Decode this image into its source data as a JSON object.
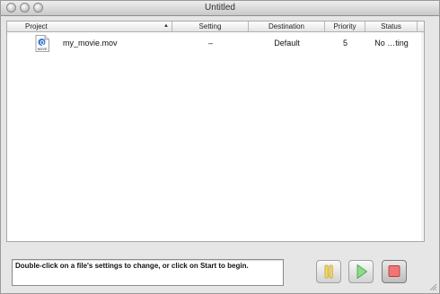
{
  "window": {
    "title": "Untitled"
  },
  "table": {
    "columns": [
      {
        "key": "project",
        "label": "Project"
      },
      {
        "key": "setting",
        "label": "Setting"
      },
      {
        "key": "destination",
        "label": "Destination"
      },
      {
        "key": "priority",
        "label": "Priority"
      },
      {
        "key": "status",
        "label": "Status"
      }
    ],
    "rows": [
      {
        "icon": "movie-file-icon",
        "icon_label": "MOVIE",
        "project": "my_movie.mov",
        "setting": "–",
        "destination": "Default",
        "priority": "5",
        "status": "No …ting"
      }
    ]
  },
  "footer": {
    "message": "Double-click on a file's settings to change, or click on Start to begin.",
    "buttons": [
      {
        "name": "pause",
        "icon": "pause-icon",
        "accent": "#e8c23a"
      },
      {
        "name": "start",
        "icon": "play-icon",
        "accent": "#5cc05c"
      },
      {
        "name": "stop",
        "icon": "stop-icon",
        "accent": "#e04848"
      }
    ]
  }
}
